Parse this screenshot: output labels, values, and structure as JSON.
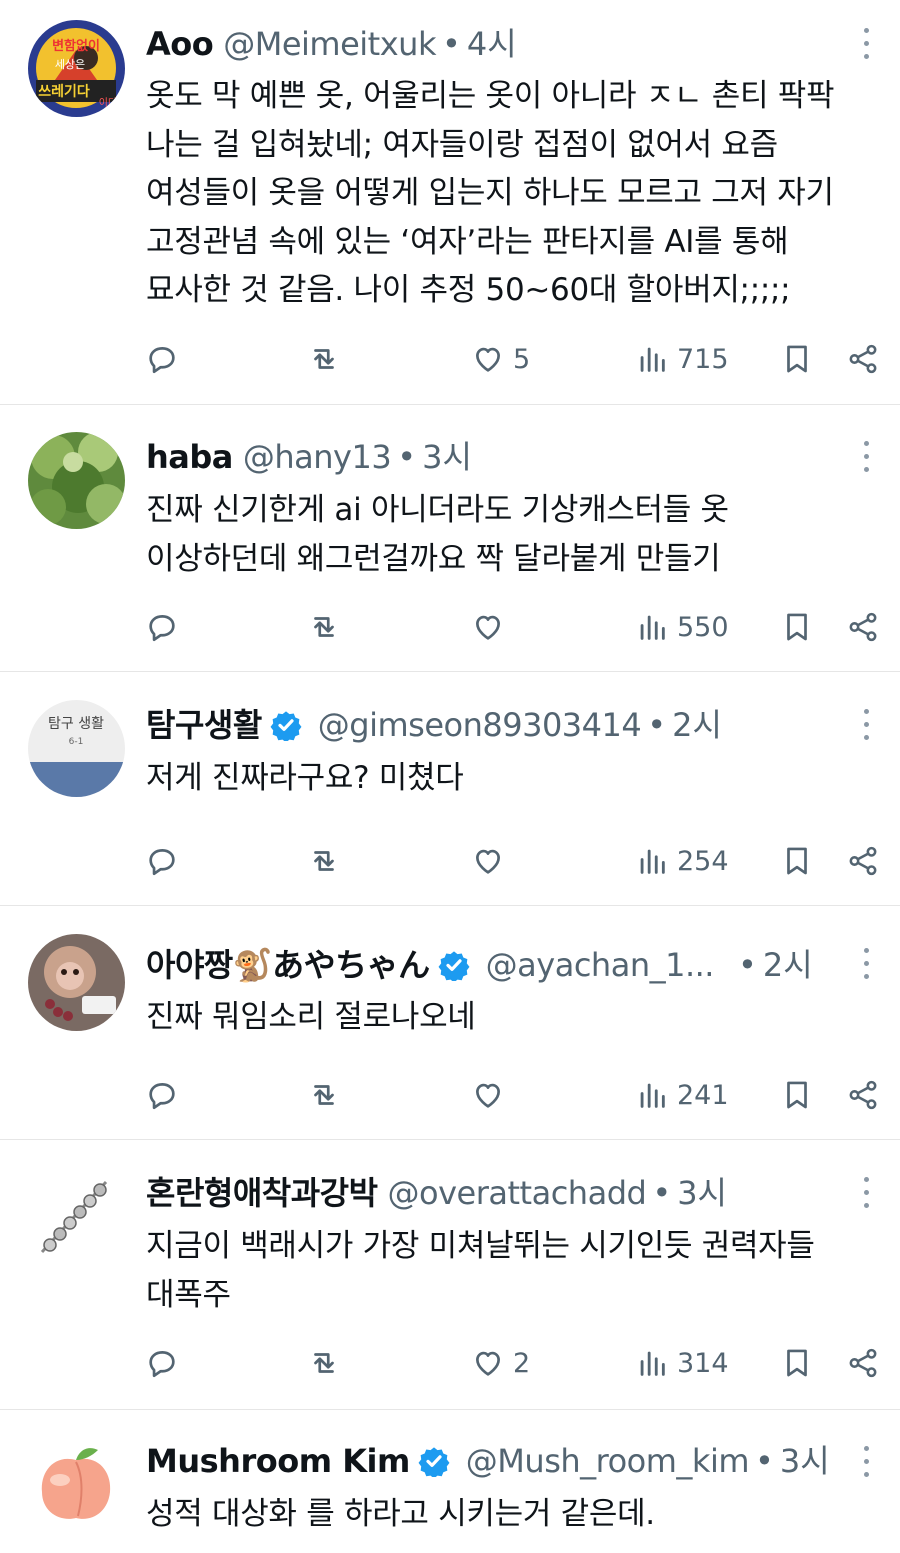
{
  "tweets": [
    {
      "name": "Aoo",
      "handle": "@Meimeitxuk",
      "time": "4시",
      "verified": false,
      "text": "옷도 막 예쁜 옷, 어울리는 옷이 아니라 ㅈㄴ 촌티 팍팍\n나는 걸 입혀놨네; 여자들이랑 접점이 없어서 요즘\n여성들이 옷을 어떻게 입는지 하나도 모르고 그저 자기\n고정관념 속에 있는 ‘여자’라는 판타지를 AI를 통해\n묘사한 것 같음. 나이 추정 50~60대 할아버지;;;;;",
      "likes": "5",
      "views": "715",
      "avatar_text": [
        "변함없이",
        "세상은",
        "쓰레기다",
        "이다"
      ]
    },
    {
      "name": "haba",
      "handle": "@hany13",
      "time": "3시",
      "verified": false,
      "text": "진짜 신기한게 ai 아니더라도 기상캐스터들 옷\n이상하던데 왜그런걸까요 짝 달라붙게 만들기",
      "likes": "",
      "views": "550"
    },
    {
      "name": "탐구생활",
      "handle": "@gimseon89303414",
      "time": "2시",
      "verified": true,
      "text": "저게 진짜라구요? 미쳤다",
      "likes": "",
      "views": "254",
      "avatar_text": [
        "탐구 생활",
        "6-1"
      ]
    },
    {
      "name": "아야짱🐒あやちゃん",
      "handle": "@ayachan_1...",
      "time": "2시",
      "verified": true,
      "text": "진짜 뭐임소리 절로나오네",
      "likes": "",
      "views": "241"
    },
    {
      "name": "혼란형애착과강박",
      "handle": "@overattachadd",
      "time": "3시",
      "verified": false,
      "text": "지금이 백래시가 가장 미쳐날뛰는 시기인듯 권력자들\n대폭주",
      "likes": "2",
      "views": "314"
    },
    {
      "name": "Mushroom Kim",
      "handle": "@Mush_room_kim",
      "time": "3시",
      "verified": true,
      "text": "성적 대상화 를 하라고 시키는거 같은데.",
      "likes": "",
      "views": ""
    }
  ],
  "colors": {
    "text": "#0f1419",
    "secondary": "#536471",
    "verified": "#1d9bf0",
    "divider": "#e6e6e6"
  },
  "icons": [
    "reply-icon",
    "retweet-icon",
    "like-icon",
    "views-icon",
    "bookmark-icon",
    "share-icon",
    "more-icon",
    "verified-badge-icon"
  ]
}
